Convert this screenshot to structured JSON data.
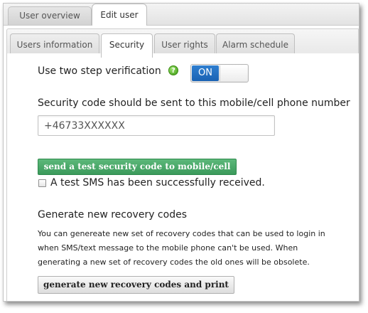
{
  "top_tabs": [
    {
      "label": "User overview",
      "active": false
    },
    {
      "label": "Edit user",
      "active": true
    }
  ],
  "sub_tabs": [
    {
      "label": "Users information",
      "active": false
    },
    {
      "label": "Security",
      "active": true
    },
    {
      "label": "User rights",
      "active": false
    },
    {
      "label": "Alarm schedule",
      "active": false
    }
  ],
  "security": {
    "two_step_label": "Use two step verification",
    "help_icon": "question-mark-icon",
    "help_glyph": "?",
    "toggle_state": "ON",
    "phone_label": "Security code should be sent to this mobile/cell phone number",
    "phone_value": "+46733XXXXXX",
    "send_test_button": "send a test security code to mobile/cell",
    "sms_received_label": "A test SMS has been successfully received.",
    "sms_received_checked": false,
    "recovery_heading": "Generate new recovery codes",
    "recovery_text_lines": [
      "You can genereate new set of recovery codes that can be used to login in",
      "when SMS/text message to the mobile phone can't be used. When",
      "generating a new set of recovery codes the old ones will be obsolete."
    ],
    "generate_button": "generate new recovery codes and print"
  },
  "colors": {
    "toggle_on": "#2a74c6",
    "send_button": "#4aa96a",
    "help_icon": "#58b52a"
  }
}
